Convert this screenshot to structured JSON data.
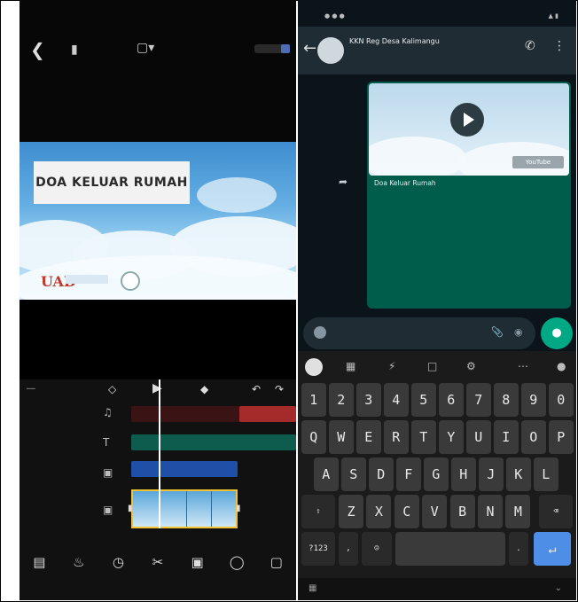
{
  "editor": {
    "video_title": "DOA KELUAR RUMAH",
    "logo_text": "UAD"
  },
  "chat": {
    "group_name": "KKN Reg Desa Kalimangu",
    "message": {
      "link_title": "Doa Keluar Rumah",
      "youtube_badge": "YouTube"
    }
  },
  "keyboard": {
    "rows": [
      [
        "1",
        "2",
        "3",
        "4",
        "5",
        "6",
        "7",
        "8",
        "9",
        "0"
      ],
      [
        "Q",
        "W",
        "E",
        "R",
        "T",
        "Y",
        "U",
        "I",
        "O",
        "P"
      ],
      [
        "A",
        "S",
        "D",
        "F",
        "G",
        "H",
        "J",
        "K",
        "L"
      ],
      [
        "Z",
        "X",
        "C",
        "V",
        "B",
        "N",
        "M"
      ]
    ]
  },
  "icons": {
    "back": "arrow-left",
    "play": "play",
    "mic": "microphone",
    "attach": "paperclip",
    "camera": "camera",
    "call": "phone",
    "menu": "more-vertical"
  },
  "colors": {
    "whatsapp_green": "#00a884",
    "bubble": "#005c4b",
    "clip_border": "#f1c232",
    "enter_key": "#4e8ee6"
  }
}
